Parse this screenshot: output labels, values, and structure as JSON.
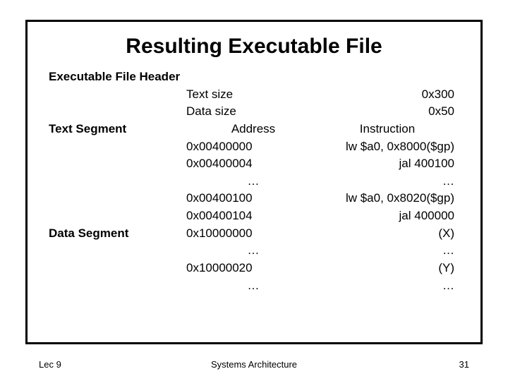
{
  "title": "Resulting Executable File",
  "sections": {
    "header": "Executable File Header",
    "text_segment": "Text Segment",
    "data_segment": "Data Segment"
  },
  "header_rows": [
    {
      "label": "Text size",
      "value": "0x300"
    },
    {
      "label": "Data size",
      "value": "0x50"
    }
  ],
  "text_cols": {
    "c2": "Address",
    "c3": "Instruction"
  },
  "text_rows": [
    {
      "addr": "0x00400000",
      "instr": "lw $a0, 0x8000($gp)"
    },
    {
      "addr": "0x00400004",
      "instr": "jal 400100"
    }
  ],
  "text_rows2": [
    {
      "addr": "0x00400100",
      "instr": "lw $a0, 0x8020($gp)"
    },
    {
      "addr": "0x00400104",
      "instr": "jal 400000"
    }
  ],
  "data_rows": [
    {
      "addr": "0x10000000",
      "val": "(X)"
    }
  ],
  "data_rows2": [
    {
      "addr": "0x10000020",
      "val": "(Y)"
    }
  ],
  "ell": "…",
  "footer": {
    "left": "Lec 9",
    "center": "Systems Architecture",
    "right": "31"
  }
}
